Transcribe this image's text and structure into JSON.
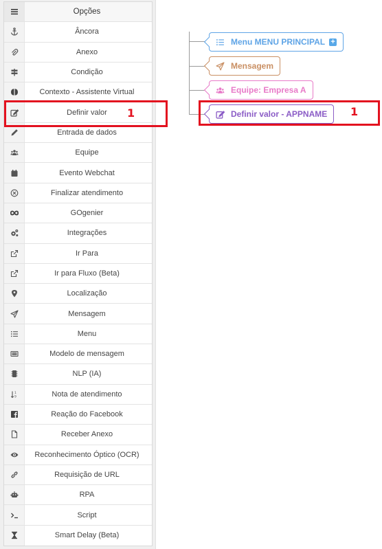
{
  "sidebar": {
    "header": "Opções",
    "items": [
      {
        "label": "Âncora",
        "icon": "anchor-icon"
      },
      {
        "label": "Anexo",
        "icon": "paperclip-icon"
      },
      {
        "label": "Condição",
        "icon": "signpost-icon"
      },
      {
        "label": "Contexto - Assistente Virtual",
        "icon": "brain-icon"
      },
      {
        "label": "Definir valor",
        "icon": "edit-icon"
      },
      {
        "label": "Entrada de dados",
        "icon": "pencil-icon"
      },
      {
        "label": "Equipe",
        "icon": "users-icon"
      },
      {
        "label": "Evento Webchat",
        "icon": "calendar-icon"
      },
      {
        "label": "Finalizar atendimento",
        "icon": "circle-x-icon"
      },
      {
        "label": "GOgenier",
        "icon": "infinity-icon"
      },
      {
        "label": "Integrações",
        "icon": "gears-icon"
      },
      {
        "label": "Ir Para",
        "icon": "external-link-icon"
      },
      {
        "label": "Ir para Fluxo (Beta)",
        "icon": "external-link-icon"
      },
      {
        "label": "Localização",
        "icon": "map-pin-icon"
      },
      {
        "label": "Mensagem",
        "icon": "paper-plane-icon"
      },
      {
        "label": "Menu",
        "icon": "list-icon"
      },
      {
        "label": "Modelo de mensagem",
        "icon": "template-icon"
      },
      {
        "label": "NLP (IA)",
        "icon": "chip-icon"
      },
      {
        "label": "Nota de atendimento",
        "icon": "sort-icon"
      },
      {
        "label": "Reação do Facebook",
        "icon": "facebook-icon"
      },
      {
        "label": "Receber Anexo",
        "icon": "file-icon"
      },
      {
        "label": "Reconhecimento Óptico (OCR)",
        "icon": "eye-icon"
      },
      {
        "label": "Requisição de URL",
        "icon": "link-icon"
      },
      {
        "label": "RPA",
        "icon": "robot-icon"
      },
      {
        "label": "Script",
        "icon": "terminal-icon"
      },
      {
        "label": "Smart Delay (Beta)",
        "icon": "hourglass-icon"
      }
    ]
  },
  "annotations": {
    "sidebar_marker": "1",
    "flow_marker": "1",
    "highlight_color": "#e3111f"
  },
  "flow": {
    "nodes": [
      {
        "label": "Menu MENU PRINCIPAL",
        "icon": "list-icon",
        "color": "#5ea4e6",
        "has_plus": true
      },
      {
        "label": "Mensagem",
        "icon": "paper-plane-icon",
        "color": "#c98f63"
      },
      {
        "label": "Equipe: Empresa A",
        "icon": "users-icon",
        "color": "#e87ac8"
      },
      {
        "label": "Definir valor - APPNAME",
        "icon": "edit-icon",
        "color": "#8b5cc6"
      }
    ]
  }
}
